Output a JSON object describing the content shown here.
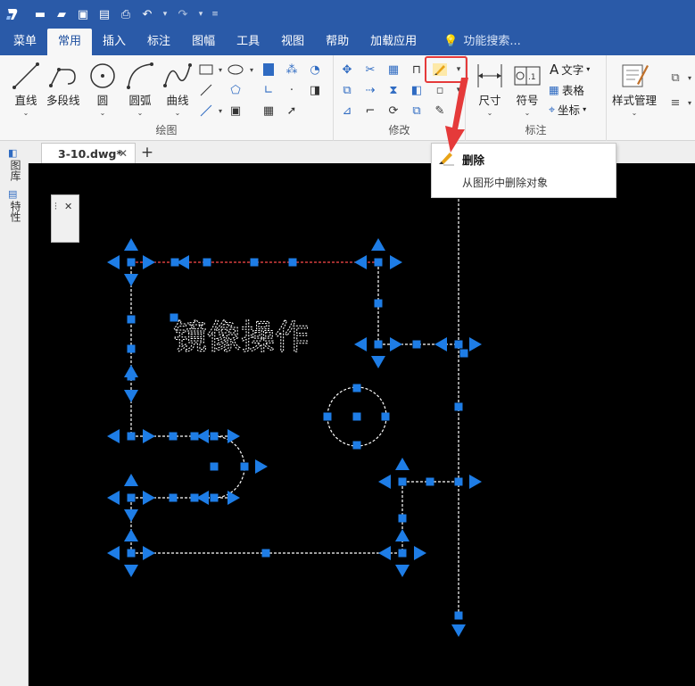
{
  "quick_access": {
    "icons": [
      "app-logo-icon",
      "new-file-icon",
      "open-folder-icon",
      "save-icon",
      "save-as-icon",
      "print-icon",
      "undo-icon",
      "redo-icon"
    ]
  },
  "ribbon_tabs": [
    "菜单",
    "常用",
    "插入",
    "标注",
    "图幅",
    "工具",
    "视图",
    "帮助",
    "加载应用"
  ],
  "active_tab": "常用",
  "search_placeholder": "功能搜索...",
  "groups": {
    "draw": {
      "label": "绘图",
      "tools": [
        "直线",
        "多段线",
        "圆",
        "圆弧",
        "曲线"
      ]
    },
    "modify": {
      "label": "修改"
    },
    "annotate": {
      "label": "标注",
      "tools": [
        "尺寸",
        "符号"
      ],
      "small_tools": [
        "文字",
        "表格",
        "坐标"
      ]
    },
    "style": {
      "tools": [
        "样式管理"
      ]
    }
  },
  "tooltip": {
    "title": "删除",
    "description": "从图形中删除对象"
  },
  "document_tab": {
    "name": "3-10.dwg*"
  },
  "side_panels": [
    "图库",
    "特性"
  ],
  "canvas": {
    "text": "镜像操作",
    "background": "#000000",
    "grip_color": "#1e7de6",
    "line_color": "#ffffff"
  }
}
